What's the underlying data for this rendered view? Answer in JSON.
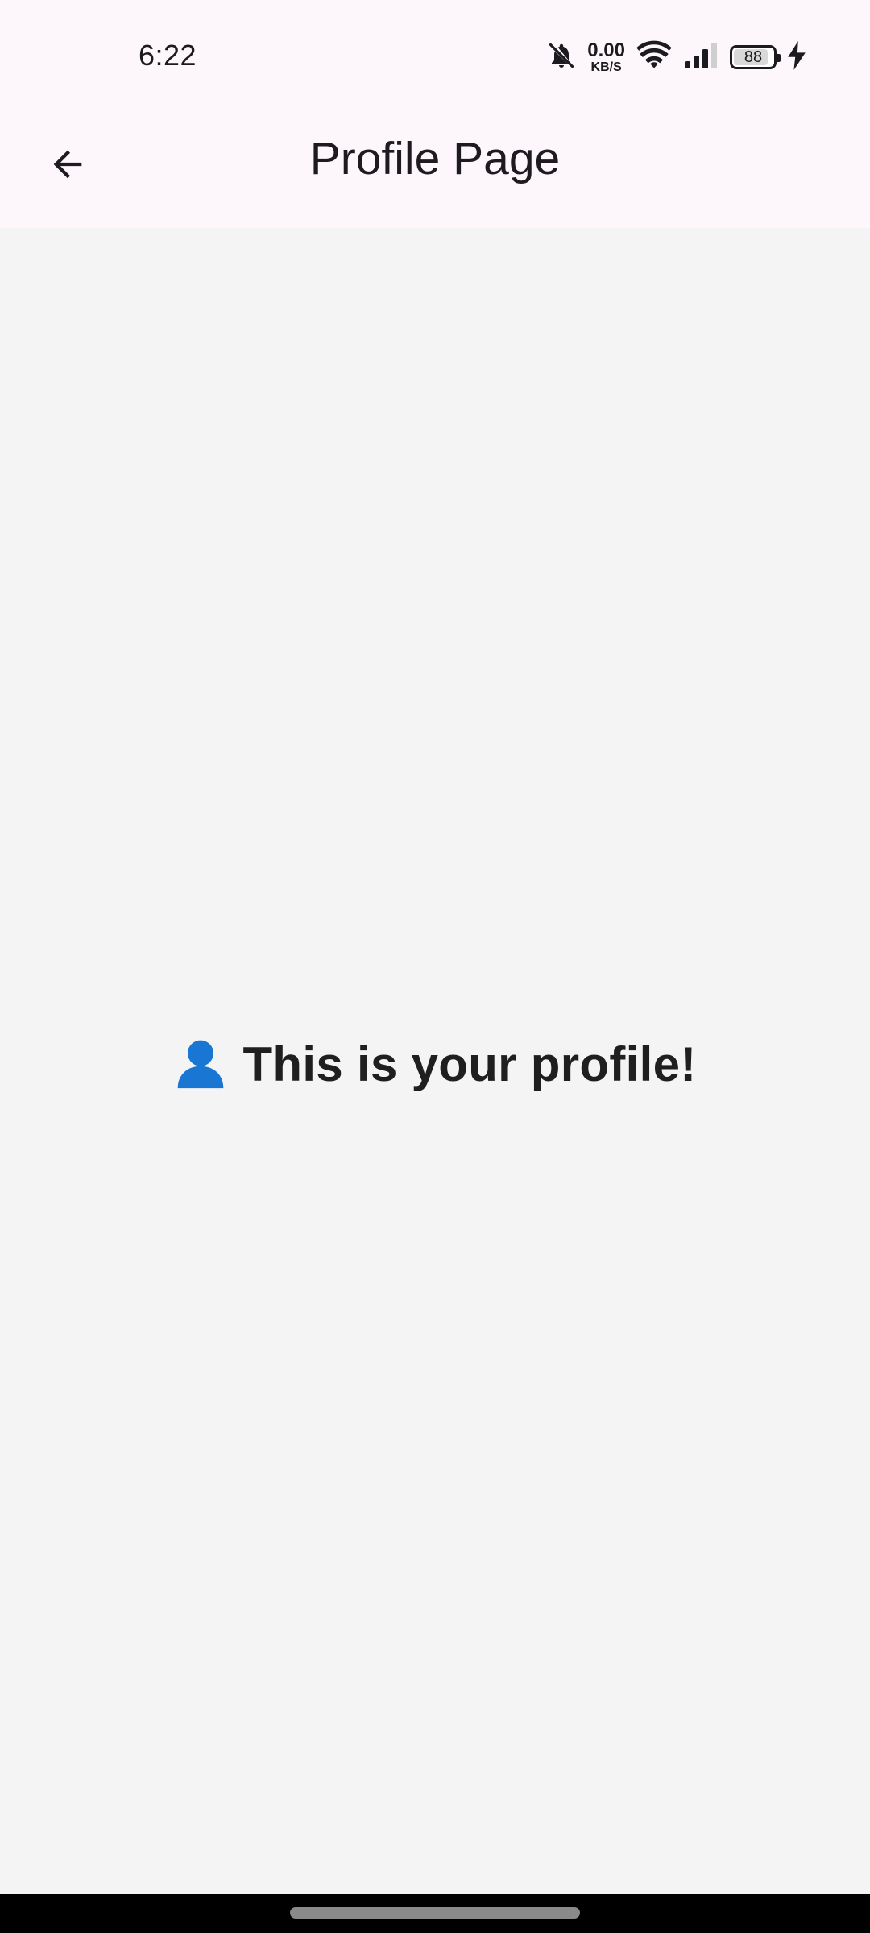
{
  "status_bar": {
    "time": "6:22",
    "net_speed_value": "0.00",
    "net_speed_unit": "KB/S",
    "battery_level": "88",
    "battery_fraction": 0.88,
    "icons": [
      "bell-off-icon",
      "wifi-icon",
      "signal-icon",
      "battery-icon",
      "charging-icon"
    ]
  },
  "app_bar": {
    "title": "Profile Page",
    "back_icon": "arrow-left-icon"
  },
  "content": {
    "emoji": "👤",
    "message": "This is your profile!"
  },
  "colors": {
    "app_bar_bg": "#fdf7fc",
    "body_bg": "#f4f4f4",
    "text": "#1d1b20",
    "emoji_blue": "#1976d2"
  }
}
